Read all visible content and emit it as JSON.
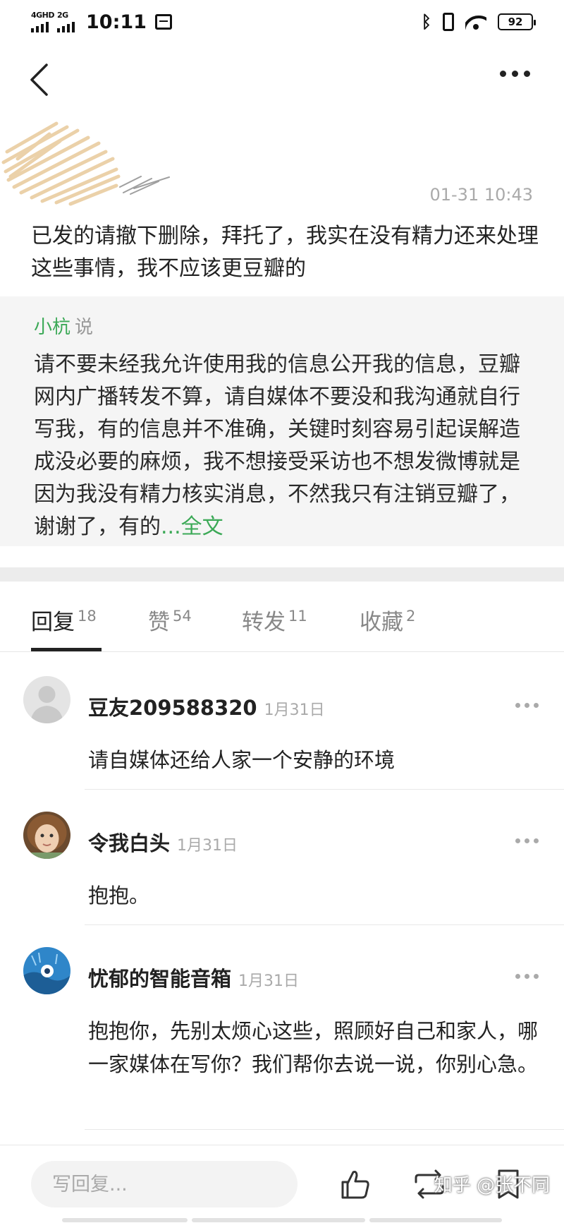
{
  "status_bar": {
    "network_1": "4GHD",
    "network_2": "2G",
    "time": "10:11",
    "battery": "92",
    "icons": [
      "signal-icon",
      "calendar-icon",
      "bluetooth-icon",
      "vibrate-icon",
      "wifi-icon",
      "battery-icon"
    ]
  },
  "nav": {
    "back_icon": "chevron-left-icon",
    "more_icon": "more-horizontal-icon"
  },
  "post": {
    "time": "01-31 10:43",
    "text": "已发的请撤下删除，拜托了，我实在没有精力还来处理这些事情，我不应该更豆瓣的"
  },
  "quote": {
    "user": "小杭",
    "say": "说",
    "text": "请不要未经我允许使用我的信息公开我的信息，豆瓣网内广播转发不算，请自媒体不要没和我沟通就自行写我，有的信息并不准确，关键时刻容易引起误解造成没必要的麻烦，我不想接受采访也不想发微博就是因为我没有精力核实消息，不然我只有注销豆瓣了，谢谢了，有的",
    "more": "...全文"
  },
  "tabs": [
    {
      "label": "回复",
      "count": "18"
    },
    {
      "label": "赞",
      "count": "54"
    },
    {
      "label": "转发",
      "count": "11"
    },
    {
      "label": "收藏",
      "count": "2"
    }
  ],
  "comments": [
    {
      "name": "豆友209588320",
      "date": "1月31日",
      "text": "请自媒体还给人家一个安静的环境"
    },
    {
      "name": "令我白头",
      "date": "1月31日",
      "text": "抱抱。"
    },
    {
      "name": "忧郁的智能音箱",
      "date": "1月31日",
      "text": "抱抱你，先别太烦心这些，照顾好自己和家人，哪一家媒体在写你？我们帮你去说一说，你别心急。"
    }
  ],
  "bottom": {
    "reply_placeholder": "写回复...",
    "watermark": "知乎 @张不同",
    "icons": [
      "like-icon",
      "repost-icon",
      "bookmark-icon"
    ]
  },
  "colors": {
    "accent_green": "#3ca957",
    "quote_bg": "#f5f5f5",
    "muted_text": "#aaaaaa"
  }
}
